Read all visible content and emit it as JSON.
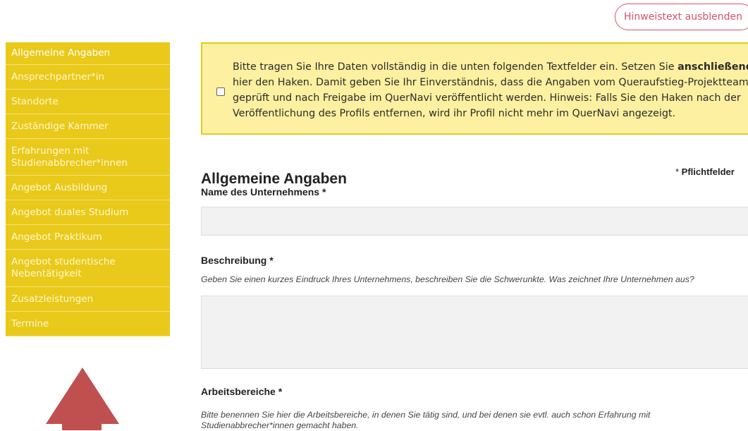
{
  "header": {
    "hint_toggle_label": "Hinweistext ausblenden"
  },
  "sidebar": {
    "items": [
      {
        "label": "Allgemeine Angaben"
      },
      {
        "label": "Ansprechpartner*in"
      },
      {
        "label": "Standorte"
      },
      {
        "label": "Zuständige Kammer"
      },
      {
        "label": "Erfahrungen mit Studienabbrecher*innen"
      },
      {
        "label": "Angebot Ausbildung"
      },
      {
        "label": "Angebot duales Studium"
      },
      {
        "label": "Angebot Praktikum"
      },
      {
        "label": "Angebot studentische Nebentätigkeit"
      },
      {
        "label": "Zusatzleistungen"
      },
      {
        "label": "Termine"
      }
    ]
  },
  "hint": {
    "text_before": "Bitte tragen Sie Ihre Daten vollständig in die unten folgenden Textfelder ein. Setzen Sie ",
    "text_bold": "anschließend",
    "text_after": " hier den Haken. Damit geben Sie Ihr Einverständnis, dass die Angaben vom Queraufstieg-Projektteam geprüft und nach Freigabe im QuerNavi veröffentlicht werden. Hinweis: Falls Sie den Haken nach der Veröffentlichung des Profils entfernen, wird ihr Profil nicht mehr im QuerNavi angezeigt."
  },
  "main": {
    "title": "Allgemeine Angaben",
    "required_star": "* ",
    "required_label": "Pflichtfelder",
    "fields": {
      "company_name": {
        "label": "Name des Unternehmens *",
        "value": ""
      },
      "description": {
        "label": "Beschreibung *",
        "help": "Geben Sie einen kurzes Eindruck Ihres Unternehmens, beschreiben Sie die Schwerunkte. Was zeichnet Ihre Unternehmen aus?",
        "value": ""
      },
      "work_areas": {
        "label": "Arbeitsbereiche *",
        "help": "Bitte benennen Sie hier die Arbeitsbereiche, in denen Sie tätig sind, und bei denen sie evtl. auch schon Erfahrung mit Studienabbrecher*innen gemacht haben."
      }
    }
  },
  "colors": {
    "sidebar_bg": "#e9c91a",
    "hint_bg": "#fdf0a0",
    "accent_pink": "#d9536a",
    "arrow": "#c0504f"
  },
  "icons": {
    "arrow": "arrow-up-icon"
  }
}
